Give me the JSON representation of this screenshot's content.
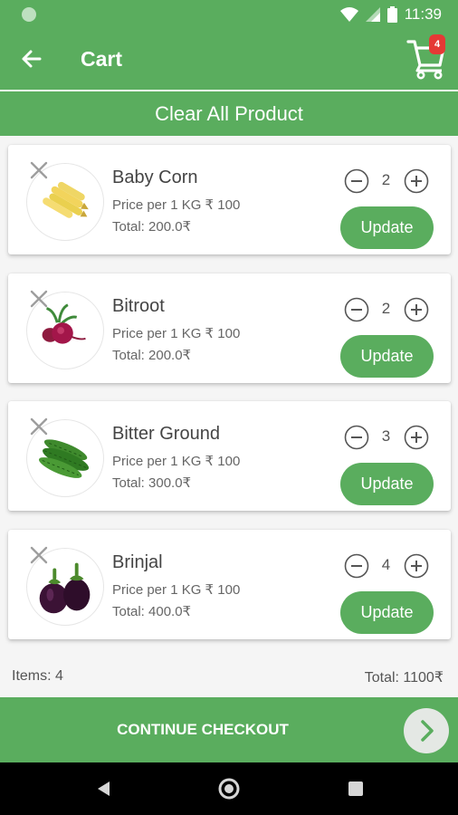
{
  "status": {
    "time": "11:39"
  },
  "header": {
    "title": "Cart",
    "cart_count": "4"
  },
  "clear_all_label": "Clear All Product",
  "cart": {
    "price_label": "Price per 1 KG",
    "update_label": "Update",
    "items": [
      {
        "name": "Baby Corn",
        "price": "₹  100",
        "total": "Total: 200.0₹",
        "qty": "2"
      },
      {
        "name": "Bitroot",
        "price": "₹  100",
        "total": "Total: 200.0₹",
        "qty": "2"
      },
      {
        "name": "Bitter Ground",
        "price": "₹  100",
        "total": "Total: 300.0₹",
        "qty": "3"
      },
      {
        "name": "Brinjal",
        "price": "₹  100",
        "total": "Total: 400.0₹",
        "qty": "4"
      }
    ]
  },
  "summary": {
    "items": "Items: 4",
    "total": "Total: 1100₹"
  },
  "checkout_label": "CONTINUE CHECKOUT",
  "icons": {
    "back": "arrow-left-icon",
    "cart": "shopping-cart-icon",
    "remove": "close-icon",
    "minus": "minus-circle-icon",
    "plus": "plus-circle-icon",
    "checkout": "chevron-right-icon"
  },
  "colors": {
    "primary": "#5aad5e",
    "badge": "#e53935"
  }
}
